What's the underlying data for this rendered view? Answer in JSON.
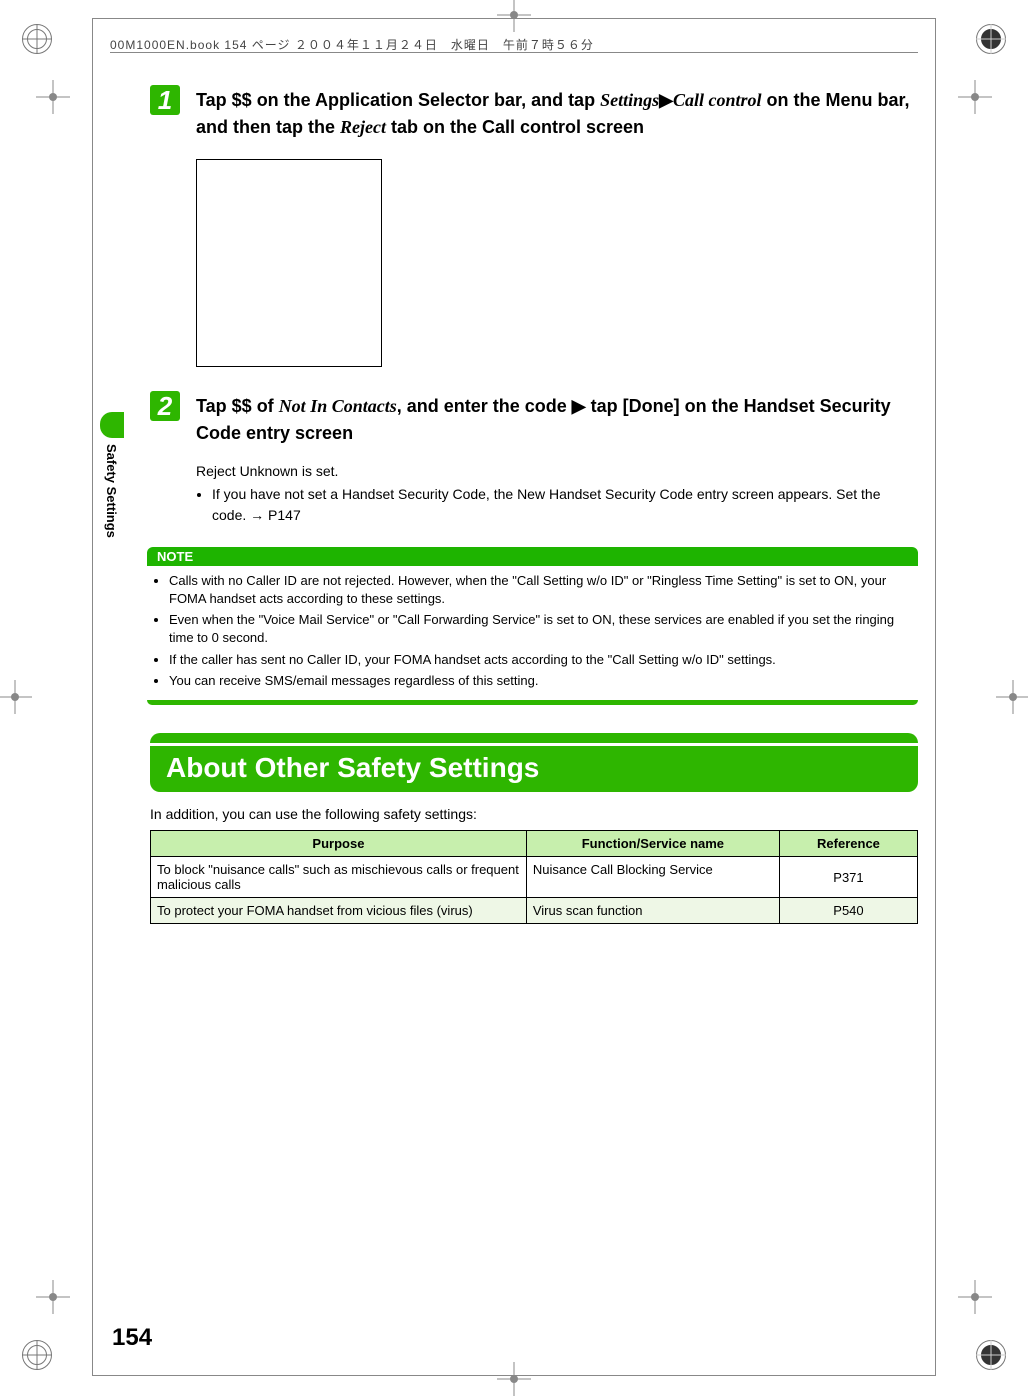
{
  "header": {
    "running": "00M1000EN.book  154 ページ  ２００４年１１月２４日　水曜日　午前７時５６分"
  },
  "side_tab": {
    "label": "Safety Settings"
  },
  "steps": [
    {
      "num": "1",
      "parts": {
        "p1": "Tap $$ on the Application Selector bar, and tap ",
        "italic1": "Settings",
        "sep1": " ▶ ",
        "italic2": "Call control",
        "p2": " on the Menu bar, and then tap the ",
        "italic3": "Reject",
        "p3": " tab on the Call control screen"
      }
    },
    {
      "num": "2",
      "parts": {
        "p1": "Tap $$ of ",
        "italic1": "Not In Contacts",
        "p2": ", and enter the code ▶ tap [Done] on the Handset Security Code entry screen"
      },
      "sub": {
        "line": "Reject Unknown is set.",
        "bullet": "If you have not set a Handset Security Code, the New Handset Security Code entry screen appears. Set the code. → P147"
      }
    }
  ],
  "note": {
    "label": "NOTE",
    "bullets": [
      "Calls with no Caller ID are not rejected. However, when the \"Call Setting w/o ID\" or \"Ringless Time Setting\" is set to ON, your FOMA handset acts according to these settings.",
      "Even when the \"Voice Mail Service\" or \"Call Forwarding Service\" is set to ON, these services are enabled if you set the ringing time to 0 second.",
      "If the caller has sent no Caller ID, your FOMA handset acts according to the \"Call Setting w/o ID\" settings.",
      "You can receive SMS/email messages regardless of this setting."
    ]
  },
  "section": {
    "title": "About Other Safety Settings",
    "intro": "In addition, you can use the following safety settings:"
  },
  "table": {
    "headers": {
      "purpose": "Purpose",
      "func": "Function/Service name",
      "ref": "Reference"
    },
    "rows": [
      {
        "purpose": "To block \"nuisance calls\" such as mischievous calls or frequent malicious calls",
        "func": "Nuisance Call Blocking Service",
        "ref": "P371"
      },
      {
        "purpose": "To protect your FOMA handset from vicious files (virus)",
        "func": "Virus scan function",
        "ref": "P540"
      }
    ]
  },
  "page_number": "154"
}
